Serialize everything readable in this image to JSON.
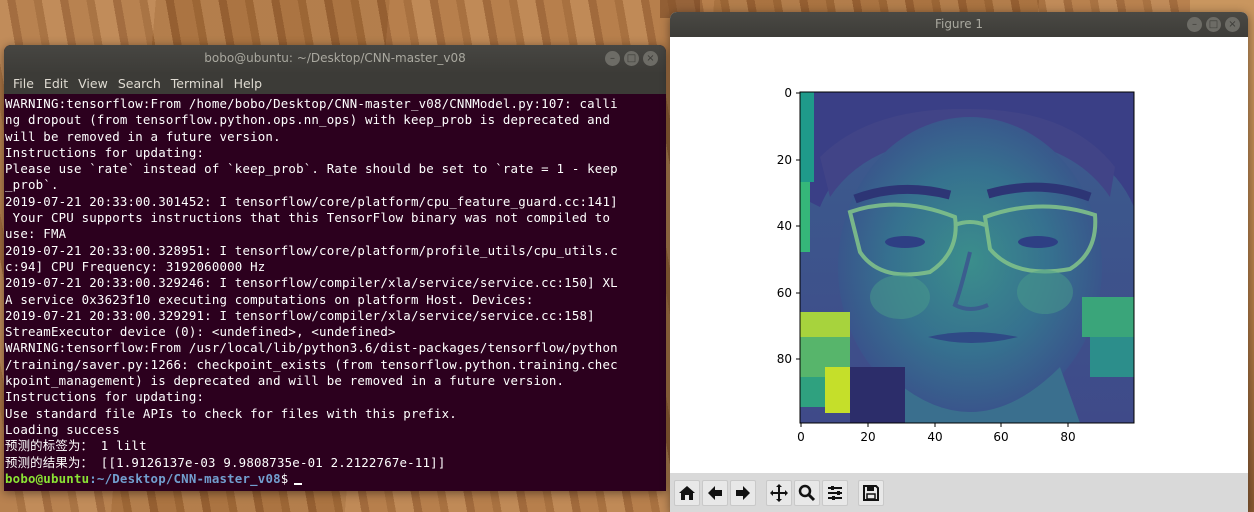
{
  "terminal": {
    "title": "bobo@ubuntu: ~/Desktop/CNN-master_v08",
    "menu": [
      "File",
      "Edit",
      "View",
      "Search",
      "Terminal",
      "Help"
    ],
    "lines": [
      "WARNING:tensorflow:From /home/bobo/Desktop/CNN-master_v08/CNNModel.py:107: calli",
      "ng dropout (from tensorflow.python.ops.nn_ops) with keep_prob is deprecated and",
      "will be removed in a future version.",
      "Instructions for updating:",
      "Please use `rate` instead of `keep_prob`. Rate should be set to `rate = 1 - keep",
      "_prob`.",
      "2019-07-21 20:33:00.301452: I tensorflow/core/platform/cpu_feature_guard.cc:141]",
      " Your CPU supports instructions that this TensorFlow binary was not compiled to",
      "use: FMA",
      "2019-07-21 20:33:00.328951: I tensorflow/core/platform/profile_utils/cpu_utils.c",
      "c:94] CPU Frequency: 3192060000 Hz",
      "2019-07-21 20:33:00.329246: I tensorflow/compiler/xla/service/service.cc:150] XL",
      "A service 0x3623f10 executing computations on platform Host. Devices:",
      "2019-07-21 20:33:00.329291: I tensorflow/compiler/xla/service/service.cc:158]",
      "StreamExecutor device (0): <undefined>, <undefined>",
      "WARNING:tensorflow:From /usr/local/lib/python3.6/dist-packages/tensorflow/python",
      "/training/saver.py:1266: checkpoint_exists (from tensorflow.python.training.chec",
      "kpoint_management) is deprecated and will be removed in a future version.",
      "Instructions for updating:",
      "Use standard file APIs to check for files with this prefix.",
      "Loading success",
      "预测的标签为： 1 lilt",
      "预测的结果为： [[1.9126137e-03 9.9808735e-01 2.2122767e-11]]"
    ],
    "prompt_user": "bobo@ubuntu",
    "prompt_path": ":~/Desktop/CNN-master_v08",
    "prompt_symbol": "$"
  },
  "figure": {
    "title": "Figure 1",
    "y_ticks": [
      "0",
      "20",
      "40",
      "60",
      "80"
    ],
    "x_ticks": [
      "0",
      "20",
      "40",
      "60",
      "80"
    ],
    "colormap": "viridis",
    "toolbar": {
      "home": "home-icon",
      "back": "arrow-left-icon",
      "forward": "arrow-right-icon",
      "pan": "move-icon",
      "zoom": "magnifier-icon",
      "configure": "sliders-icon",
      "save": "floppy-disk-icon"
    }
  }
}
